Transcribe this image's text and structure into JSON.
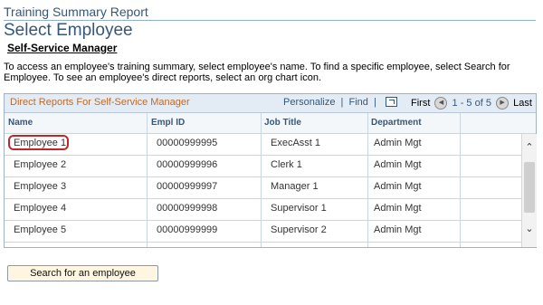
{
  "header": {
    "report_title": "Training Summary Report",
    "page_title": "Select Employee",
    "section_title": "Self-Service Manager",
    "instructions": "To access an employee's training summary, select employee's name.  To find a specific employee, select Search for Employee.  To see an employee's direct reports, select an org chart icon."
  },
  "grid": {
    "caption": "Direct Reports For Self-Service Manager",
    "personalize_label": "Personalize",
    "find_label": "Find",
    "separator": "|",
    "download_icon": "download-icon",
    "first_label": "First",
    "range": "1 - 5",
    "of_label": "of",
    "total": "5",
    "last_label": "Last",
    "columns": [
      "Name",
      "Empl ID",
      "Job Title",
      "Department"
    ],
    "rows": [
      {
        "name": "Employee 1",
        "id": "00000999995",
        "title": "ExecAsst 1",
        "dept": "Admin Mgt",
        "selected": true
      },
      {
        "name": "Employee 2",
        "id": "00000999996",
        "title": "Clerk 1",
        "dept": "Admin Mgt",
        "selected": false
      },
      {
        "name": "Employee 3",
        "id": "00000999997",
        "title": "Manager 1",
        "dept": "Admin Mgt",
        "selected": false
      },
      {
        "name": "Employee 4",
        "id": "00000999998",
        "title": "Supervisor 1",
        "dept": "Admin Mgt",
        "selected": false
      },
      {
        "name": "Employee 5",
        "id": "00000999999",
        "title": "Supervisor 2",
        "dept": "Admin Mgt",
        "selected": false
      }
    ]
  },
  "actions": {
    "search_label": "Search for an employee"
  },
  "colors": {
    "title_blue": "#35577c",
    "caption_orange": "#bd6a2c",
    "highlight_red": "#c0262c"
  }
}
